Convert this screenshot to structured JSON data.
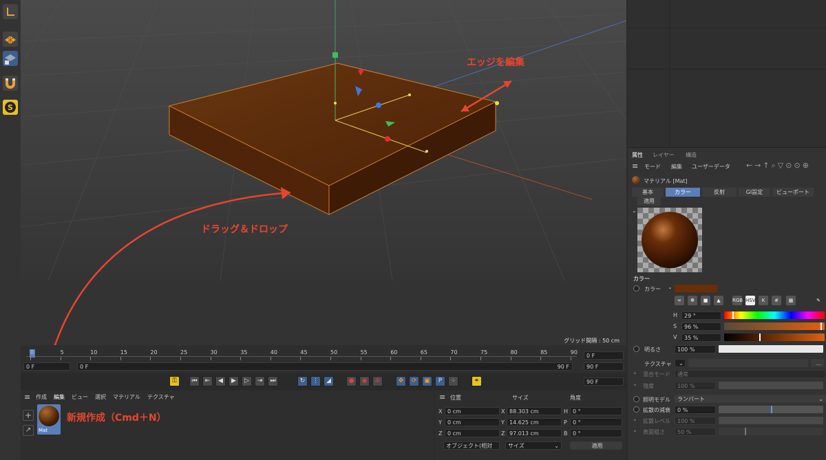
{
  "viewport": {
    "grid_spacing": "グリッド間隔 : 50 cm",
    "annotation_edge": "エッジを編集",
    "annotation_drag": "ドラッグ＆ドロップ"
  },
  "timeline": {
    "ticks": [
      "0",
      "5",
      "10",
      "15",
      "20",
      "25",
      "30",
      "35",
      "40",
      "45",
      "50",
      "55",
      "60",
      "65",
      "70",
      "75",
      "80",
      "85",
      "90"
    ],
    "current_frame": "0 F",
    "start_frame": "0 F",
    "min_frame": "0 F",
    "max_frame": "90 F",
    "end_frame": "90 F",
    "preview_end": "90 F"
  },
  "material_manager": {
    "menu": [
      "作成",
      "編集",
      "ビュー",
      "選択",
      "マテリアル",
      "テクスチャ"
    ],
    "material_name": "Mat",
    "annotation_new": "新規作成（Cmd＋N）"
  },
  "coordinates": {
    "headers": [
      "位置",
      "サイズ",
      "角度"
    ],
    "rows": [
      {
        "axis": "X",
        "pos": "0 cm",
        "size_axis": "X",
        "size": "88.303 cm",
        "rot_axis": "H",
        "rot": "0 °"
      },
      {
        "axis": "Y",
        "pos": "0 cm",
        "size_axis": "Y",
        "size": "14.625 cm",
        "rot_axis": "P",
        "rot": "0 °"
      },
      {
        "axis": "Z",
        "pos": "0 cm",
        "size_axis": "Z",
        "size": "97.013 cm",
        "rot_axis": "B",
        "rot": "0 °"
      }
    ],
    "mode_select": "オブジェクト(相対",
    "size_select": "サイズ",
    "apply_label": "適用"
  },
  "attributes": {
    "top_tabs": [
      "属性",
      "レイヤー",
      "構造"
    ],
    "menu": [
      "モード",
      "編集",
      "ユーザーデータ"
    ],
    "material_title": "マテリアル [Mat]",
    "tabs_row1": [
      "基本",
      "カラー",
      "反射",
      "GI設定",
      "ビューポート"
    ],
    "tabs_row2": [
      "適用"
    ],
    "section_color": "カラー",
    "color_label": "カラー",
    "color_value": "#6a2e08",
    "picker_modes": [
      "RGB",
      "HSV",
      "K",
      "#"
    ],
    "hsv": [
      {
        "label": "H",
        "value": "29 °",
        "fraction": 0.081
      },
      {
        "label": "S",
        "value": "96 %",
        "fraction": 0.96
      },
      {
        "label": "V",
        "value": "35 %",
        "fraction": 0.35
      }
    ],
    "brightness_label": "明るさ",
    "brightness_value": "100 %",
    "texture_label": "テクスチャ",
    "blend_mode_label": "混合モード",
    "blend_mode_value": "通常",
    "strength_label": "強度",
    "strength_value": "100 %",
    "illum_model_label": "照明モデル",
    "illum_model_value": "ランバート",
    "diffuse_falloff_label": "拡散の減衰",
    "diffuse_falloff_value": "0 %",
    "diffuse_level_label": "拡散レベル",
    "diffuse_level_value": "100 %",
    "roughness_label": "表面粗さ",
    "roughness_value": "50 %",
    "colors": {
      "accent": "#5a7fb8",
      "annotation": "#e8452c"
    }
  }
}
